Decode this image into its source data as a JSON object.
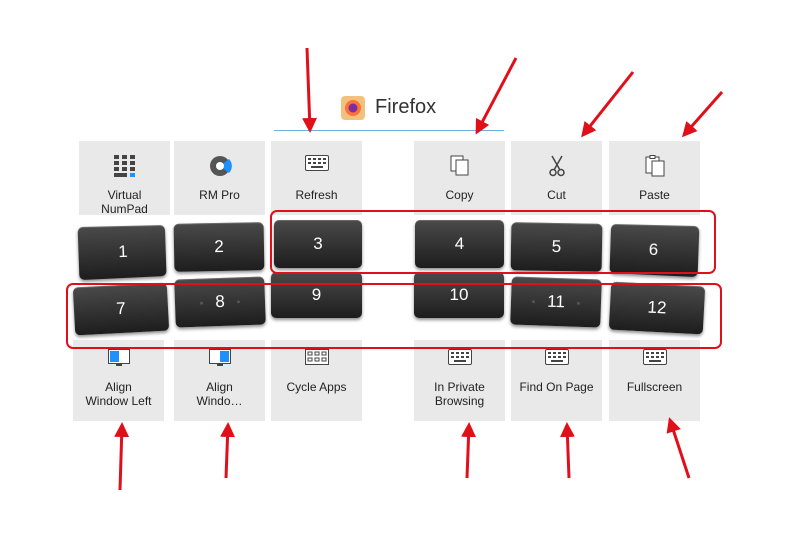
{
  "header": {
    "title": "Firefox",
    "icon": "firefox-icon"
  },
  "accent_color": "#e0101a",
  "top_actions": [
    {
      "label": "Virtual\nNumPad",
      "icon": "numpad-icon"
    },
    {
      "label": "RM Pro",
      "icon": "rm-pro-icon"
    },
    {
      "label": "Refresh",
      "icon": "keyboard-icon"
    },
    {
      "label": "Copy",
      "icon": "copy-icon"
    },
    {
      "label": "Cut",
      "icon": "scissors-icon"
    },
    {
      "label": "Paste",
      "icon": "paste-icon"
    }
  ],
  "keys": [
    "1",
    "2",
    "3",
    "4",
    "5",
    "6",
    "7",
    "8",
    "9",
    "10",
    "11",
    "12"
  ],
  "bottom_actions": [
    {
      "label": "Align\nWindow Left",
      "icon": "window-left-icon"
    },
    {
      "label": "Align\nWindo…",
      "icon": "window-right-icon"
    },
    {
      "label": "Cycle Apps",
      "icon": "grid-icon"
    },
    {
      "label": "In Private\nBrowsing",
      "icon": "keyboard-icon"
    },
    {
      "label": "Find On Page",
      "icon": "keyboard-icon"
    },
    {
      "label": "Fullscreen",
      "icon": "keyboard-icon"
    }
  ]
}
